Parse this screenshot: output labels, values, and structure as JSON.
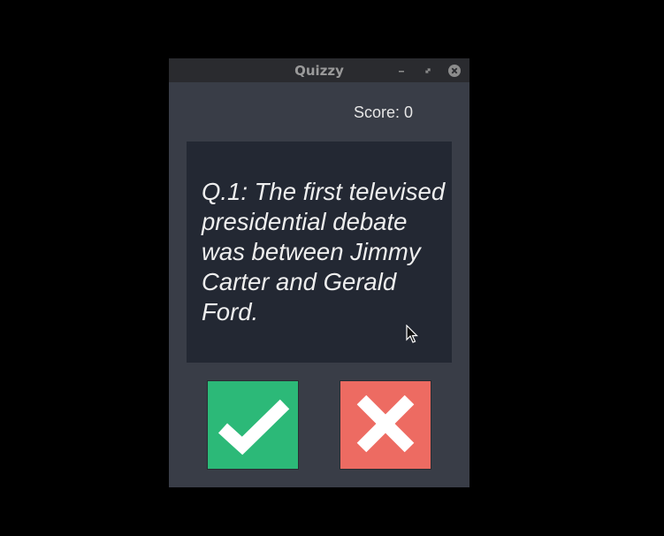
{
  "window": {
    "title": "Quizzy"
  },
  "score": {
    "text": "Score: 0"
  },
  "question": {
    "text": "Q.1: The first televised presidential debate was between Jimmy Carter and Gerald Ford."
  },
  "answers": [
    {
      "id": "true",
      "icon": "checkmark-icon",
      "color": "#2cb978"
    },
    {
      "id": "false",
      "icon": "cross-icon",
      "color": "#ed6b62"
    }
  ],
  "colors": {
    "screen_background": "#000000",
    "window_background": "#393d47",
    "titlebar": "#2a2b2f",
    "card_background": "#232833",
    "text": "#eeeeee"
  }
}
